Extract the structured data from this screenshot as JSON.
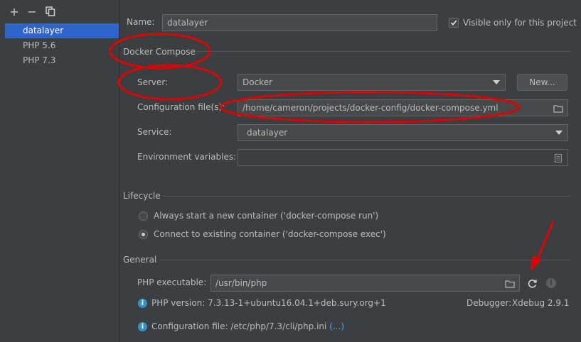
{
  "toolbar": {
    "add_icon": "plus-icon",
    "remove_icon": "minus-icon",
    "copy_icon": "copy-icon"
  },
  "interpreters": [
    {
      "label": "datalayer",
      "selected": true
    },
    {
      "label": "PHP 5.6",
      "selected": false
    },
    {
      "label": "PHP 7.3",
      "selected": false
    }
  ],
  "name": {
    "label": "Name:",
    "value": "datalayer"
  },
  "visible_only": {
    "label": "Visible only for this project",
    "checked": true
  },
  "docker_compose": {
    "section_title": "Docker Compose",
    "server_label": "Server:",
    "server_value": "Docker",
    "new_button": "New...",
    "config_label": "Configuration file(s):",
    "config_value": "/home/cameron/projects/docker-config/docker-compose.yml",
    "service_label": "Service:",
    "service_value": "datalayer",
    "env_label": "Environment variables:",
    "env_value": ""
  },
  "lifecycle": {
    "section_title": "Lifecycle",
    "options": [
      {
        "label": "Always start a new container ('docker-compose run')",
        "selected": false
      },
      {
        "label": "Connect to existing container ('docker-compose exec')",
        "selected": true
      }
    ]
  },
  "general": {
    "section_title": "General",
    "php_exe_label": "PHP executable:",
    "php_exe_value": "/usr/bin/php",
    "php_version": "PHP version: 7.3.13-1+ubuntu16.04.1+deb.sury.org+1",
    "debugger_label": "Debugger:",
    "debugger_value": "Xdebug 2.9.1",
    "config_file_text": "Configuration file: /etc/php/7.3/cli/php.ini",
    "config_file_link": "(...)"
  },
  "colors": {
    "background": "#3c3f41",
    "selection": "#2f65ca",
    "annotation": "#e00000",
    "info": "#3592c4"
  }
}
